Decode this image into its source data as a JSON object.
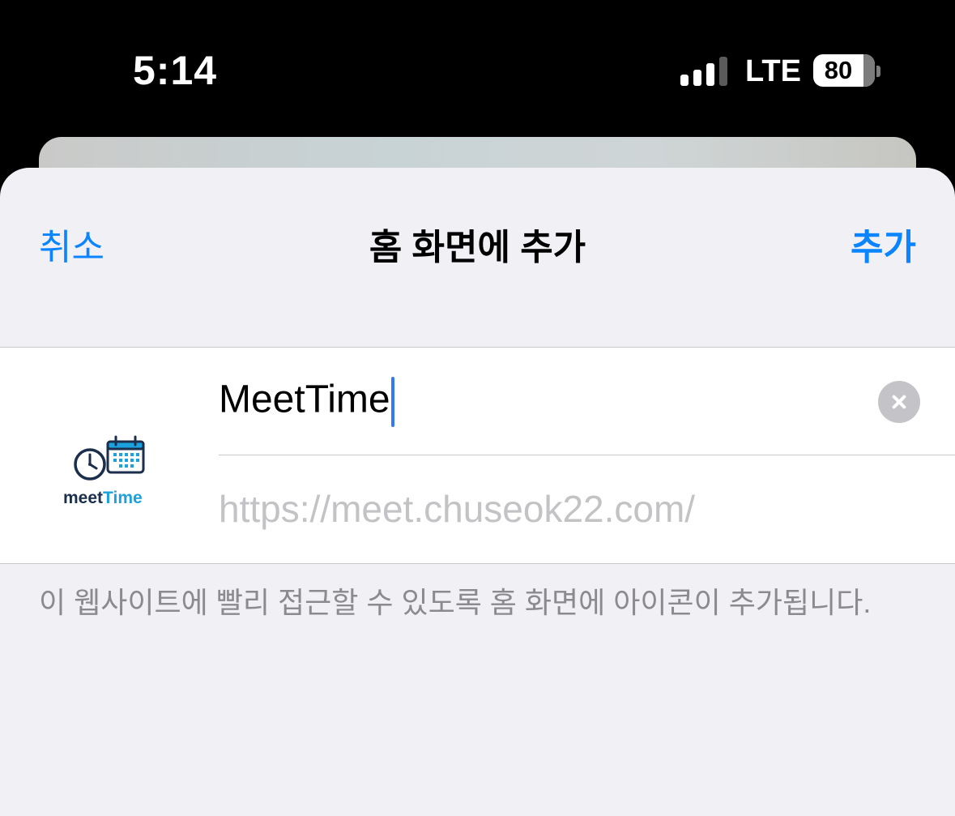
{
  "status_bar": {
    "time": "5:14",
    "network": "LTE",
    "battery_level": "80"
  },
  "nav": {
    "cancel_label": "취소",
    "title": "홈 화면에 추가",
    "add_label": "추가"
  },
  "form": {
    "name_value": "MeetTime",
    "url_value": "https://meet.chuseok22.com/",
    "icon": {
      "name": "meettime-app-icon",
      "logo_text_dark": "meet",
      "logo_text_accent": "Time"
    }
  },
  "footer_note": "이 웹사이트에 빨리 접근할 수 있도록 홈 화면에 아이콘이 추가됩니다.",
  "colors": {
    "accent": "#0a84ff",
    "caret": "#3478f6",
    "logo_dark": "#1b2e4b",
    "logo_accent": "#1ba1dd"
  }
}
